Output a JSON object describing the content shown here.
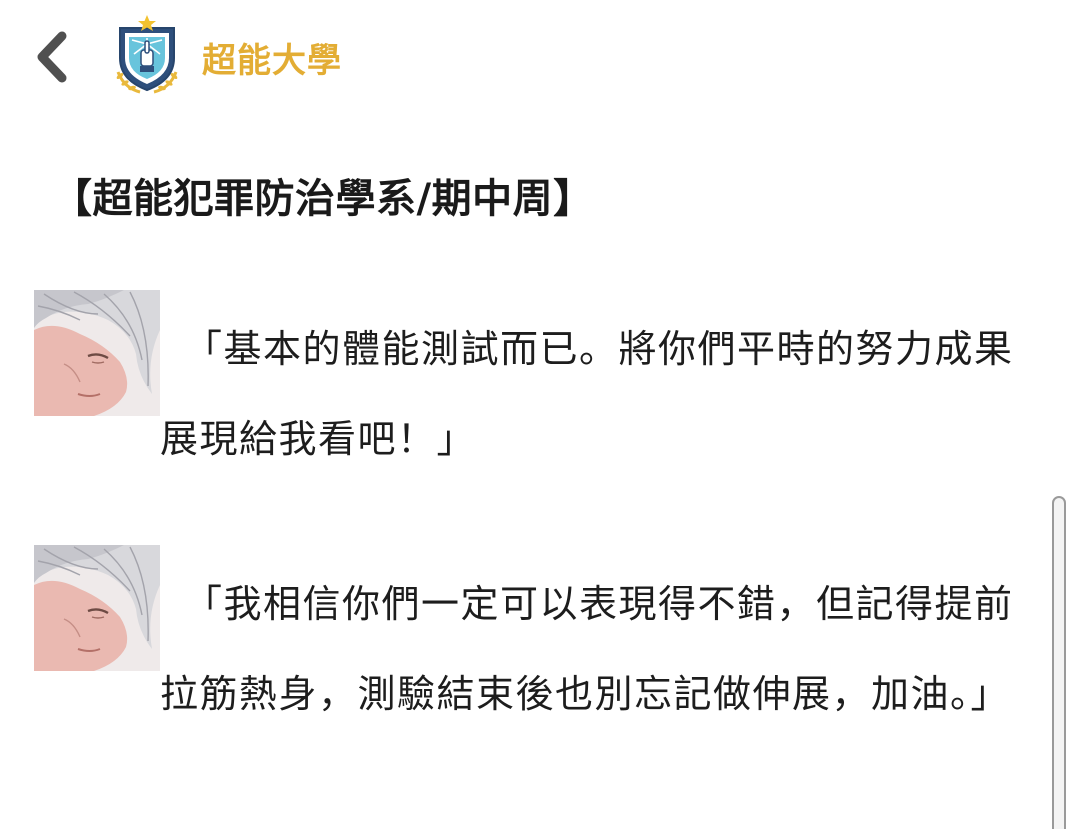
{
  "header": {
    "back_icon": "chevron-left-icon",
    "logo_icon": "shield-crest-logo",
    "app_name": "超能大學",
    "app_name_color": "#e3ad34"
  },
  "post": {
    "title": "【超能犯罪防治學系/期中周】",
    "dialogues": [
      {
        "avatar_icon": "silver-haired-character-portrait",
        "text": "「基本的體能測試而已。將你們平時的努力成果展現給我看吧！」"
      },
      {
        "avatar_icon": "silver-haired-character-portrait",
        "text": "「我相信你們一定可以表現得不錯，但記得提前拉筋熱身，測驗結束後也別忘記做伸展，加油。」"
      }
    ]
  },
  "colors": {
    "background": "#ffffff",
    "text": "#1d1d1d",
    "accent": "#e3ad34"
  }
}
